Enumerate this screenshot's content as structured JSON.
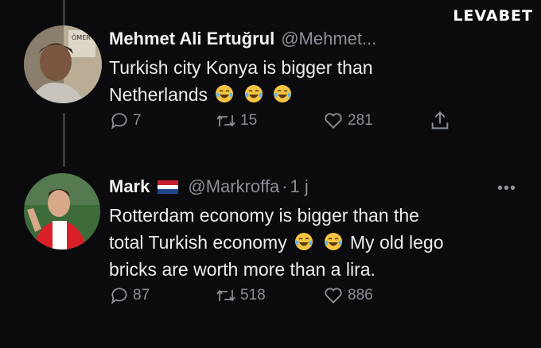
{
  "watermark": {
    "text": "LEVABET"
  },
  "tweets": [
    {
      "display_name": "Mehmet Ali Ertuğrul",
      "handle": "@Mehmet...",
      "text_line1": "Turkish city Konya is bigger than",
      "text_line2": "Netherlands",
      "emojis": [
        "face-with-tears-of-joy",
        "face-with-tears-of-joy",
        "face-with-tears-of-joy"
      ],
      "reply_count": "7",
      "retweet_count": "15",
      "like_count": "281",
      "avatar_sign": "ÖMER"
    },
    {
      "display_name": "Mark",
      "flag": "netherlands-flag",
      "handle": "@Markroffa",
      "dot": "·",
      "time": "1 j",
      "more": "•••",
      "text_line1": "Rotterdam economy is bigger than the",
      "text_line2_a": "total Turkish economy",
      "emojis": [
        "face-with-tears-of-joy",
        "face-with-tears-of-joy"
      ],
      "text_line2_b": "My old lego",
      "text_line3": "bricks are worth more than a lira.",
      "reply_count": "87",
      "retweet_count": "518",
      "like_count": "886"
    }
  ],
  "colors": {
    "background": "#0b0b0e",
    "text": "#ececef",
    "muted": "#8b8f96",
    "thread_line": "#3a3a40"
  }
}
